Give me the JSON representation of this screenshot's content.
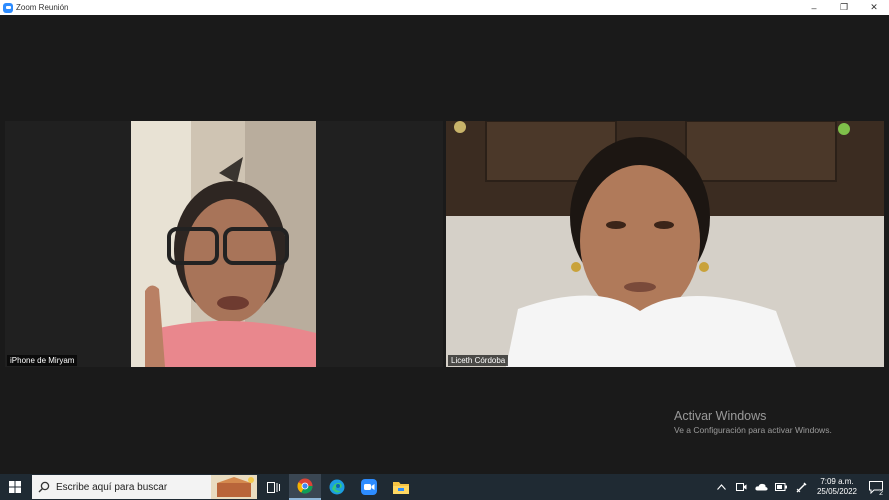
{
  "window": {
    "title": "Zoom Reunión"
  },
  "participants": [
    {
      "name": "iPhone de Miryam"
    },
    {
      "name": "Liceth Córdoba"
    }
  ],
  "watermark": {
    "title": "Activar Windows",
    "subtitle": "Ve a Configuración para activar Windows."
  },
  "taskbar": {
    "search_placeholder": "Escribe aquí para buscar",
    "time": "7:09 a.m.",
    "date": "25/05/2022",
    "notification_count": "2"
  }
}
